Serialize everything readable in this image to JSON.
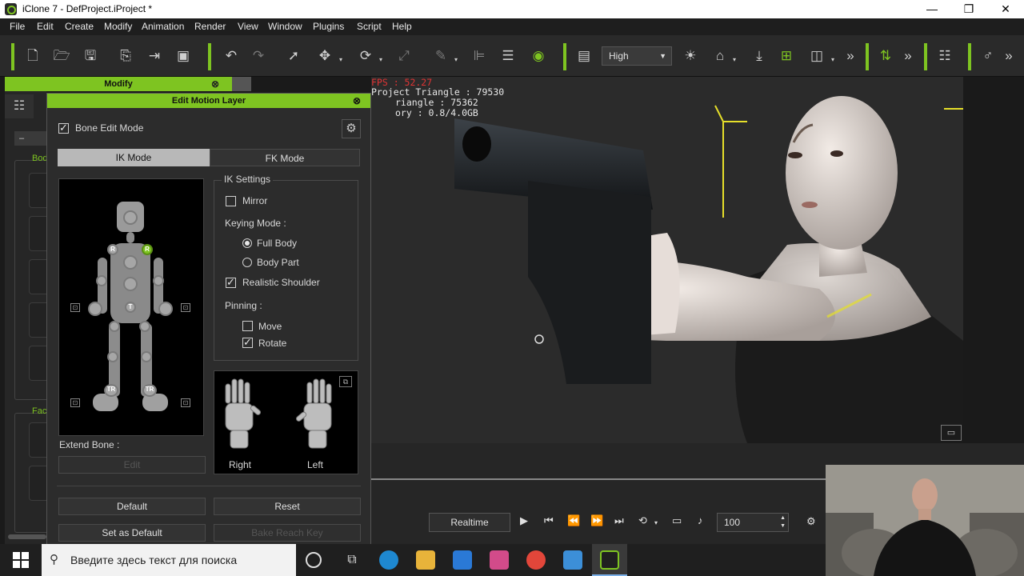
{
  "window": {
    "title": "iClone 7 - DefProject.iProject *"
  },
  "window_controls": {
    "minimize": "—",
    "maximize": "❐",
    "close": "✕"
  },
  "menu": [
    "File",
    "Edit",
    "Create",
    "Modify",
    "Animation",
    "Render",
    "View",
    "Window",
    "Plugins",
    "Script",
    "Help"
  ],
  "toolbar": {
    "quality": "High",
    "overflow1": "»",
    "overflow2": "»",
    "overflow3": "»",
    "accent": "#7ec421"
  },
  "left_panel": {
    "header": "Modify",
    "close": "⊗",
    "group1_label": "Bod",
    "group2_label": "Fac",
    "collapse": "–"
  },
  "dialog": {
    "title": "Edit Motion Layer",
    "close": "⊗",
    "bone_edit_mode": {
      "label": "Bone Edit Mode",
      "checked": true
    },
    "tabs": {
      "ik": "IK Mode",
      "fk": "FK Mode"
    },
    "ik_settings": {
      "title": "IK Settings",
      "mirror": "Mirror",
      "keying_mode_label": "Keying Mode :",
      "full_body": "Full Body",
      "body_part": "Body Part",
      "realistic_shoulder": "Realistic Shoulder",
      "pinning_label": "Pinning :",
      "move": "Move",
      "rotate": "Rotate"
    },
    "figure_markers": {
      "r_left": "R",
      "r_right": "R",
      "t": "T",
      "tr_left": "TR",
      "tr_right": "TR"
    },
    "hands": {
      "right": "Right",
      "left": "Left"
    },
    "extend_bone": "Extend Bone :",
    "edit": "Edit",
    "default": "Default",
    "reset": "Reset",
    "set_as_default": "Set as Default",
    "bake_reach_key": "Bake Reach Key"
  },
  "viewport": {
    "fps": "FPS : 52.27",
    "project_triangle": "Project Triangle : 79530",
    "triangle": "riangle : 75362",
    "memory": "ory : 0.8/4.0GB"
  },
  "timeline": {
    "realtime": "Realtime",
    "frame": "100"
  },
  "taskbar": {
    "search_placeholder": "Введите здесь текст для поиска"
  }
}
